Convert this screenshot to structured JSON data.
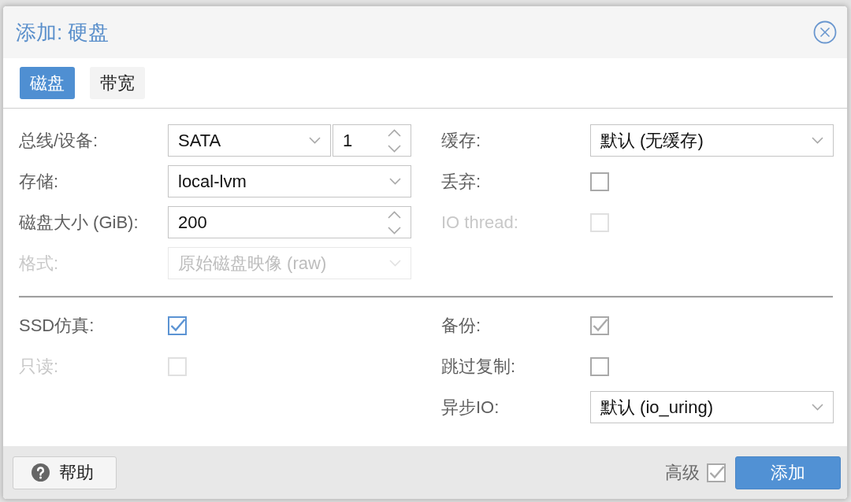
{
  "window": {
    "title": "添加: 硬盘"
  },
  "tabs": [
    {
      "label": "磁盘",
      "selected": true
    },
    {
      "label": "带宽",
      "selected": false
    }
  ],
  "left_fields": [
    {
      "kind": "bus_device",
      "label": "总线/设备:",
      "value": "SATA",
      "device": "1",
      "disabled": false,
      "focused": false
    },
    {
      "kind": "select",
      "label": "存储:",
      "value": "local-lvm",
      "disabled": false,
      "focused": false
    },
    {
      "kind": "spinner",
      "label": "磁盘大小 (GiB):",
      "value": "200",
      "disabled": false,
      "focused": false
    },
    {
      "kind": "select",
      "label": "格式:",
      "value": "原始磁盘映像 (raw)",
      "disabled": true,
      "focused": false
    }
  ],
  "right_fields": [
    {
      "kind": "select",
      "label": "缓存:",
      "value": "默认 (无缓存)",
      "disabled": false,
      "focused": false
    },
    {
      "kind": "checkbox",
      "label": "丢弃:",
      "checked": false,
      "disabled": false,
      "focused": false
    },
    {
      "kind": "checkbox",
      "label": "IO thread:",
      "checked": false,
      "disabled": true,
      "focused": false
    }
  ],
  "advanced_left": [
    {
      "kind": "checkbox",
      "label": "SSD仿真:",
      "checked": true,
      "disabled": false,
      "focused": true
    },
    {
      "kind": "checkbox",
      "label": "只读:",
      "checked": false,
      "disabled": true,
      "focused": false
    }
  ],
  "advanced_right": [
    {
      "kind": "checkbox",
      "label": "备份:",
      "checked": true,
      "disabled": false,
      "focused": false
    },
    {
      "kind": "checkbox",
      "label": "跳过复制:",
      "checked": false,
      "disabled": false,
      "focused": false
    },
    {
      "kind": "select",
      "label": "异步IO:",
      "value": "默认 (io_uring)",
      "disabled": false,
      "focused": false
    }
  ],
  "footer": {
    "help_button": "帮助",
    "advanced": {
      "label": "高级",
      "checked": true
    },
    "add_button": "添加"
  }
}
